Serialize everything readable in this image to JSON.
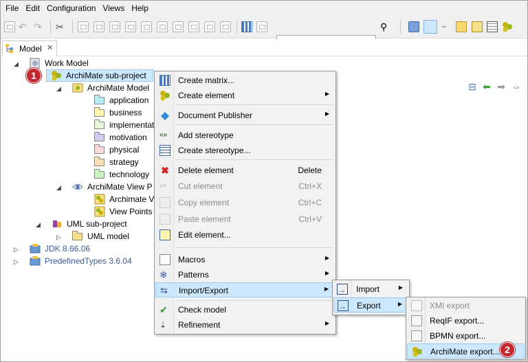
{
  "menubar": {
    "items": [
      "File",
      "Edit",
      "Configuration",
      "Views",
      "Help"
    ]
  },
  "toolbar": {
    "combo_value": ""
  },
  "tab": {
    "label": "Model",
    "close": "✕"
  },
  "tree": {
    "work_model": "Work Model",
    "archimate_subproject": "ArchiMate sub-project",
    "archimate_model": "ArchiMate Model",
    "folders": [
      {
        "label": "application",
        "color": "#b8ecf5"
      },
      {
        "label": "business",
        "color": "#fff9b0"
      },
      {
        "label": "implementati",
        "color": "#e4f8d8"
      },
      {
        "label": "motivation",
        "color": "#d0ccef"
      },
      {
        "label": "physical",
        "color": "#fbd9d9"
      },
      {
        "label": "strategy",
        "color": "#f8e0b8"
      },
      {
        "label": "technology",
        "color": "#c9f2bf"
      }
    ],
    "archimate_view": "ArchiMate View P",
    "view_children": [
      "Archimate V",
      "View Points"
    ],
    "uml_subproject": "UML sub-project",
    "uml_model": "UML model",
    "jdk": "JDK 8.66.06",
    "predefined": "PredefinedTypes 3.6.04"
  },
  "context_menu": {
    "items": [
      {
        "label": "Create matrix...",
        "icon": "matrix-icon"
      },
      {
        "label": "Create element",
        "icon": "archimate-icon",
        "submenu": true
      },
      {
        "label": "Document Publisher",
        "icon": "document-icon",
        "submenu": true
      },
      {
        "label": "Add stereotype",
        "icon": "stereotype-add-icon"
      },
      {
        "label": "Create stereotype...",
        "icon": "stereotype-create-icon"
      },
      {
        "label": "Delete element",
        "shortcut": "Delete",
        "icon": "delete-icon"
      },
      {
        "label": "Cut element",
        "shortcut": "Ctrl+X",
        "icon": "cut-icon",
        "disabled": true
      },
      {
        "label": "Copy element",
        "shortcut": "Ctrl+C",
        "icon": "copy-icon",
        "disabled": true
      },
      {
        "label": "Paste element",
        "shortcut": "Ctrl+V",
        "icon": "paste-icon",
        "disabled": true
      },
      {
        "label": "Edit element...",
        "icon": "edit-icon"
      },
      {
        "label": "Macros",
        "icon": "macro-icon",
        "submenu": true
      },
      {
        "label": "Patterns",
        "icon": "patterns-icon",
        "submenu": true
      },
      {
        "label": "Import/Export",
        "icon": "import-export-icon",
        "submenu": true
      },
      {
        "label": "Check model",
        "icon": "check-model-icon"
      },
      {
        "label": "Refinement",
        "icon": "refinement-icon",
        "submenu": true
      }
    ]
  },
  "io_menu": {
    "import": "Import",
    "export": "Export"
  },
  "export_menu": {
    "items": [
      {
        "label": "XMI export",
        "disabled": true
      },
      {
        "label": "ReqIF export...",
        "disabled": false
      },
      {
        "label": "BPMN export...",
        "disabled": false
      },
      {
        "label": "ArchiMate export...",
        "disabled": false
      }
    ]
  },
  "badges": {
    "one": "1",
    "two": "2"
  },
  "colors": {
    "highlight": "#cce8ff",
    "badge": "#c1272d",
    "link": "#3d5a98"
  }
}
